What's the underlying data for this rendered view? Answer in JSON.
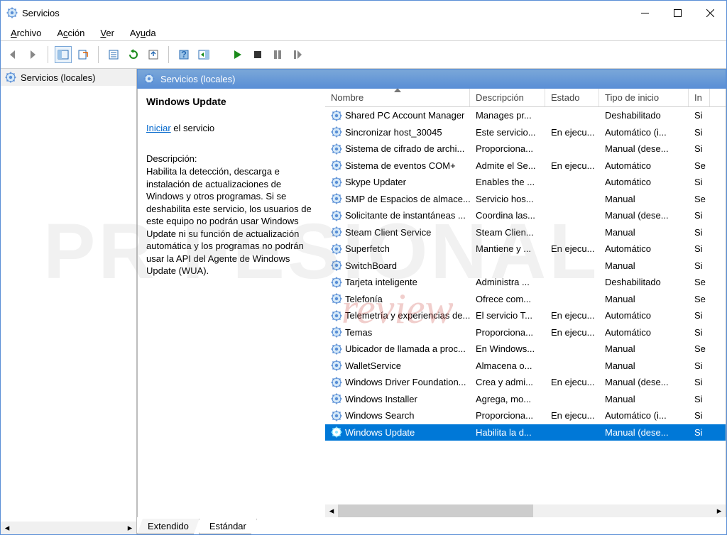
{
  "window": {
    "title": "Servicios"
  },
  "menu": {
    "file": "Archivo",
    "action": "Acción",
    "view": "Ver",
    "help": "Ayuda"
  },
  "tree": {
    "root": "Servicios (locales)"
  },
  "contentHeader": "Servicios (locales)",
  "info": {
    "serviceName": "Windows Update",
    "linkText": "Iniciar",
    "linkSuffix": " el servicio",
    "descLabel": "Descripción:",
    "descText": "Habilita la detección, descarga e instalación de actualizaciones de Windows y otros programas. Si se deshabilita este servicio, los usuarios de este equipo no podrán usar Windows Update ni su función de actualización automática y los programas no podrán usar la API del Agente de Windows Update (WUA)."
  },
  "columns": {
    "name": "Nombre",
    "desc": "Descripción",
    "state": "Estado",
    "startup": "Tipo de inicio",
    "logon": "In"
  },
  "rows": [
    {
      "name": "Shared PC Account Manager",
      "desc": "Manages pr...",
      "state": "",
      "startup": "Deshabilitado",
      "logon": "Si"
    },
    {
      "name": "Sincronizar host_30045",
      "desc": "Este servicio...",
      "state": "En ejecu...",
      "startup": "Automático (i...",
      "logon": "Si"
    },
    {
      "name": "Sistema de cifrado de archi...",
      "desc": "Proporciona...",
      "state": "",
      "startup": "Manual (dese...",
      "logon": "Si"
    },
    {
      "name": "Sistema de eventos COM+",
      "desc": "Admite el Se...",
      "state": "En ejecu...",
      "startup": "Automático",
      "logon": "Se"
    },
    {
      "name": "Skype Updater",
      "desc": "Enables the ...",
      "state": "",
      "startup": "Automático",
      "logon": "Si"
    },
    {
      "name": "SMP de Espacios de almace...",
      "desc": "Servicio hos...",
      "state": "",
      "startup": "Manual",
      "logon": "Se"
    },
    {
      "name": "Solicitante de instantáneas ...",
      "desc": "Coordina las...",
      "state": "",
      "startup": "Manual (dese...",
      "logon": "Si"
    },
    {
      "name": "Steam Client Service",
      "desc": "Steam Clien...",
      "state": "",
      "startup": "Manual",
      "logon": "Si"
    },
    {
      "name": "Superfetch",
      "desc": "Mantiene y ...",
      "state": "En ejecu...",
      "startup": "Automático",
      "logon": "Si"
    },
    {
      "name": "SwitchBoard",
      "desc": "",
      "state": "",
      "startup": "Manual",
      "logon": "Si"
    },
    {
      "name": "Tarjeta inteligente",
      "desc": "Administra ...",
      "state": "",
      "startup": "Deshabilitado",
      "logon": "Se"
    },
    {
      "name": "Telefonía",
      "desc": "Ofrece com...",
      "state": "",
      "startup": "Manual",
      "logon": "Se"
    },
    {
      "name": "Telemetría y experiencias de...",
      "desc": "El servicio T...",
      "state": "En ejecu...",
      "startup": "Automático",
      "logon": "Si"
    },
    {
      "name": "Temas",
      "desc": "Proporciona...",
      "state": "En ejecu...",
      "startup": "Automático",
      "logon": "Si"
    },
    {
      "name": "Ubicador de llamada a proc...",
      "desc": "En Windows...",
      "state": "",
      "startup": "Manual",
      "logon": "Se"
    },
    {
      "name": "WalletService",
      "desc": "Almacena o...",
      "state": "",
      "startup": "Manual",
      "logon": "Si"
    },
    {
      "name": "Windows Driver Foundation...",
      "desc": "Crea y admi...",
      "state": "En ejecu...",
      "startup": "Manual (dese...",
      "logon": "Si"
    },
    {
      "name": "Windows Installer",
      "desc": "Agrega, mo...",
      "state": "",
      "startup": "Manual",
      "logon": "Si"
    },
    {
      "name": "Windows Search",
      "desc": "Proporciona...",
      "state": "En ejecu...",
      "startup": "Automático (i...",
      "logon": "Si"
    },
    {
      "name": "Windows Update",
      "desc": "Habilita la d...",
      "state": "",
      "startup": "Manual (dese...",
      "logon": "Si",
      "selected": true
    }
  ],
  "tabs": {
    "extended": "Extendido",
    "standard": "Estándar"
  },
  "watermark": {
    "big": "PR   FESIONAL",
    "small": "review"
  }
}
